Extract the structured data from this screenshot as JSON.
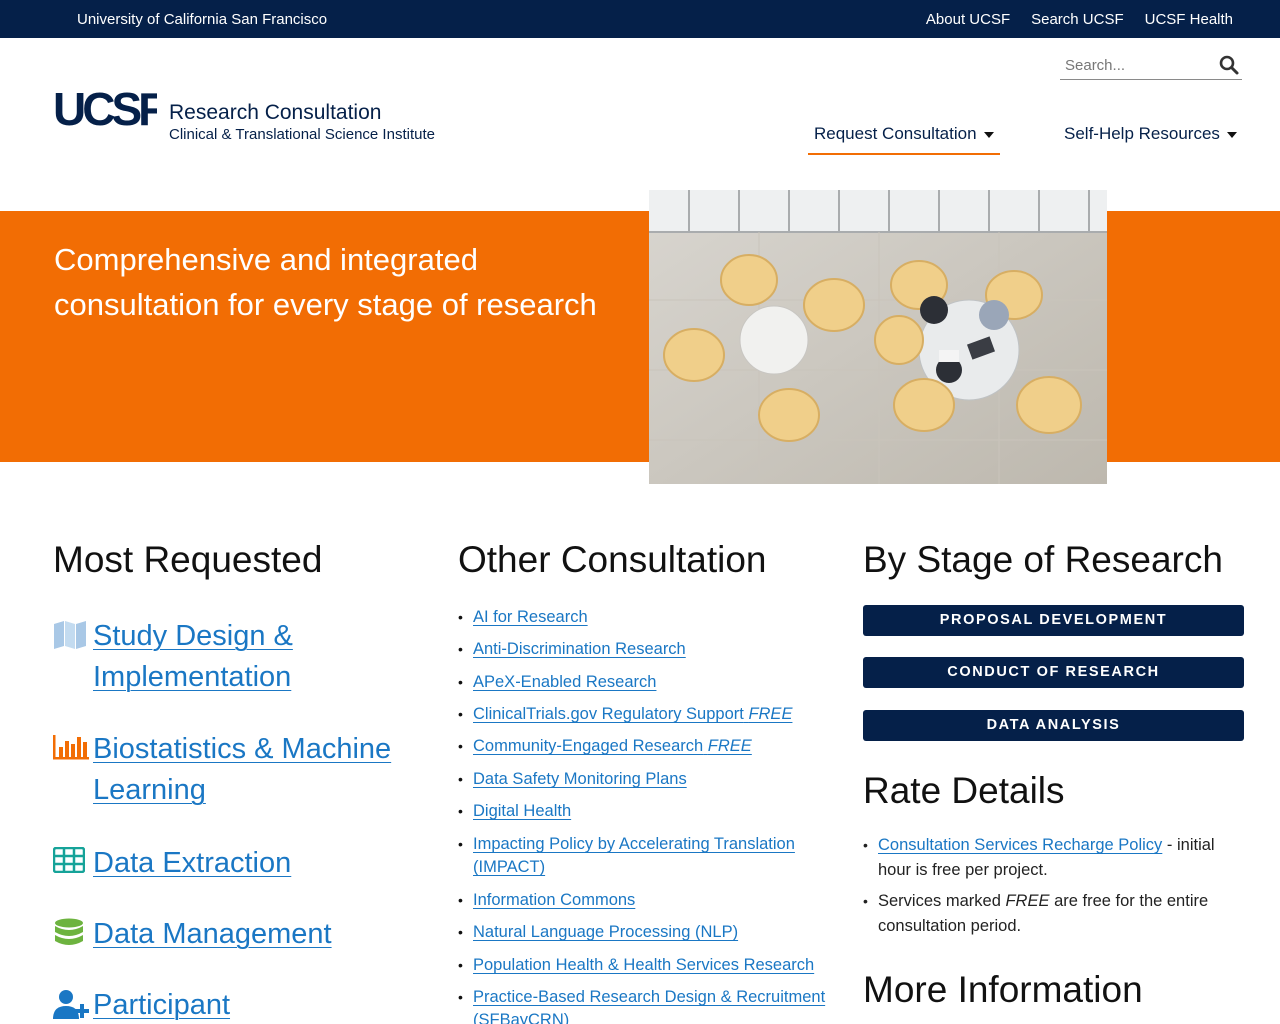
{
  "topbar": {
    "university": "University of California San Francisco",
    "links": [
      "About UCSF",
      "Search UCSF",
      "UCSF Health"
    ]
  },
  "header": {
    "logo_mark": "UCSF",
    "logo_title": "Research Consultation",
    "logo_subtitle": "Clinical & Translational Science Institute",
    "search_placeholder": "Search...",
    "nav": {
      "request": "Request Consultation",
      "self_help": "Self-Help Resources"
    }
  },
  "hero": {
    "title": "Comprehensive and integrated consultation for every stage of research",
    "image_icon": "meeting-room-photo"
  },
  "most_requested": {
    "heading": "Most Requested",
    "items": [
      {
        "icon": "map-icon",
        "label": "Study Design & Implementation",
        "lines": [
          "Study Design &",
          "Implementation"
        ]
      },
      {
        "icon": "bar-chart-icon",
        "label": "Biostatistics & Machine Learning",
        "lines": [
          "Biostatistics & Machine",
          "Learning"
        ]
      },
      {
        "icon": "table-icon",
        "label": "Data Extraction",
        "lines": [
          "Data Extraction"
        ]
      },
      {
        "icon": "database-icon",
        "label": "Data Management",
        "lines": [
          "Data Management"
        ]
      },
      {
        "icon": "user-plus-icon",
        "label": "Participant",
        "lines": [
          "Participant"
        ]
      }
    ]
  },
  "other_consultation": {
    "heading": "Other Consultation",
    "items": [
      {
        "label": "AI for Research",
        "free": ""
      },
      {
        "label": "Anti-Discrimination Research",
        "free": ""
      },
      {
        "label": "APeX-Enabled Research",
        "free": ""
      },
      {
        "label": "ClinicalTrials.gov Regulatory Support",
        "free": "FREE"
      },
      {
        "label": "Community-Engaged Research",
        "free": "FREE"
      },
      {
        "label": "Data Safety Monitoring Plans",
        "free": ""
      },
      {
        "label": "Digital Health",
        "free": ""
      },
      {
        "label": "Impacting Policy by Accelerating Translation (IMPACT)",
        "free": ""
      },
      {
        "label": "Information Commons",
        "free": ""
      },
      {
        "label": "Natural Language Processing (NLP)",
        "free": ""
      },
      {
        "label": "Population Health & Health Services Research",
        "free": ""
      },
      {
        "label": "Practice-Based Research Design & Recruitment (SFBayCRN)",
        "free": ""
      }
    ]
  },
  "by_stage": {
    "heading": "By Stage of Research",
    "buttons": [
      "PROPOSAL DEVELOPMENT",
      "CONDUCT OF RESEARCH",
      "DATA ANALYSIS"
    ]
  },
  "rate_details": {
    "heading": "Rate Details",
    "policy_link": "Consultation Services Recharge Policy",
    "policy_rest": " - initial hour is free per project.",
    "free_before": "Services marked ",
    "free_word": "FREE",
    "free_after": " are free for the entire consultation period."
  },
  "more_info": {
    "heading": "More Information"
  }
}
